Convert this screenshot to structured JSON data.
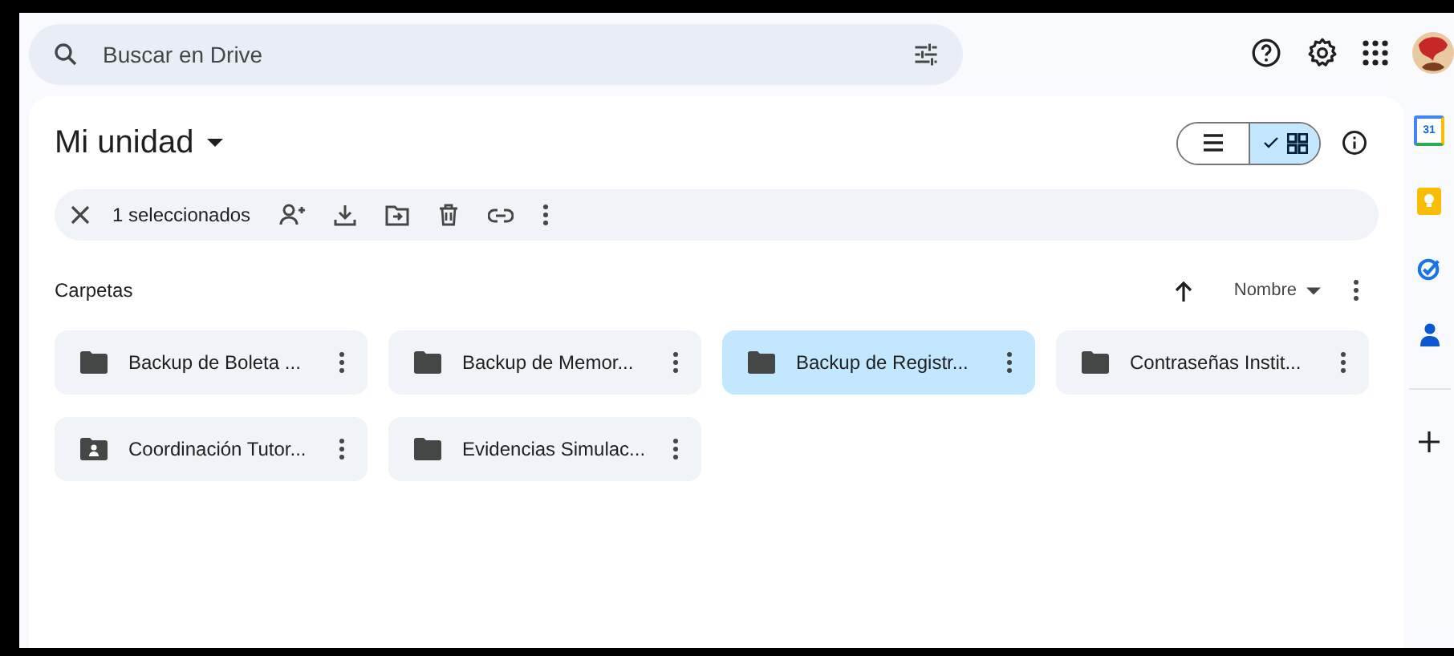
{
  "search": {
    "placeholder": "Buscar en Drive"
  },
  "title": "Mi unidad",
  "view_toggle": [
    {
      "kind": "list",
      "selected": false
    },
    {
      "kind": "grid",
      "selected": true
    }
  ],
  "selection_bar": {
    "count": "1 seleccionados"
  },
  "section": "Carpetas",
  "sort": {
    "label": "Nombre"
  },
  "folders": [
    {
      "name": "Backup de Boleta ...",
      "kind": "folder",
      "selected": false
    },
    {
      "name": "Backup de Memor...",
      "kind": "folder",
      "selected": false
    },
    {
      "name": "Backup de Registr...",
      "kind": "folder",
      "selected": true
    },
    {
      "name": "Contraseñas Instit...",
      "kind": "folder",
      "selected": false
    },
    {
      "name": "Coordinación Tutor...",
      "kind": "shared",
      "selected": false
    },
    {
      "name": "Evidencias Simulac...",
      "kind": "folder",
      "selected": false
    }
  ],
  "side_panel": {
    "calendar_day": "31"
  }
}
